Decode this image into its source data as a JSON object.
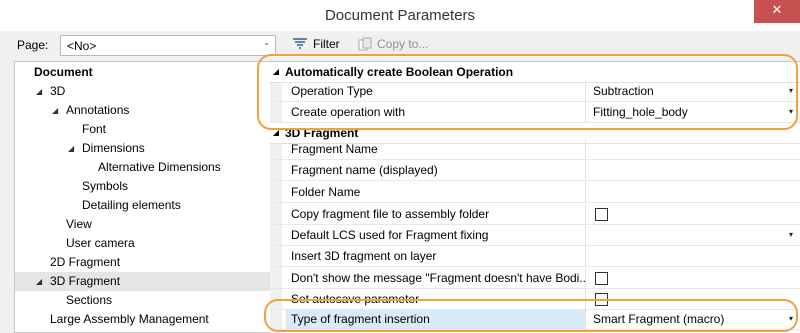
{
  "window": {
    "title": "Document Parameters",
    "close_glyph": "✕"
  },
  "page_selector": {
    "label": "Page:",
    "value": "<No>",
    "arrow": "⌄"
  },
  "toolbar": {
    "filter_label": "Filter",
    "copy_label": "Copy to..."
  },
  "tree": {
    "items": [
      {
        "label": "Document",
        "arrow": "",
        "bold": true
      },
      {
        "label": "3D",
        "arrow": "◢"
      },
      {
        "label": "Annotations",
        "arrow": "◢"
      },
      {
        "label": "Font",
        "arrow": ""
      },
      {
        "label": "Dimensions",
        "arrow": "◢"
      },
      {
        "label": "Alternative Dimensions",
        "arrow": ""
      },
      {
        "label": "Symbols",
        "arrow": ""
      },
      {
        "label": "Detailing elements",
        "arrow": ""
      },
      {
        "label": "View",
        "arrow": ""
      },
      {
        "label": "User camera",
        "arrow": ""
      },
      {
        "label": "2D Fragment",
        "arrow": ""
      },
      {
        "label": "3D Fragment",
        "arrow": "◢"
      },
      {
        "label": "Sections",
        "arrow": ""
      },
      {
        "label": "Large Assembly Management",
        "arrow": ""
      }
    ]
  },
  "grid": {
    "categories": [
      {
        "label": "Automatically create Boolean Operation",
        "arrow": "◢"
      },
      {
        "label": "3D Fragment",
        "arrow": "◢"
      }
    ],
    "boolean_rows": [
      {
        "name": "Operation Type",
        "value": "Subtraction",
        "arrow": "▾"
      },
      {
        "name": "Create operation with",
        "value": "Fitting_hole_body",
        "arrow": "▾"
      }
    ],
    "fragment_rows": [
      {
        "name": "Fragment Name",
        "value": ""
      },
      {
        "name": "Fragment name (displayed)",
        "value": ""
      },
      {
        "name": "Folder Name",
        "value": ""
      },
      {
        "name": "Copy fragment file to assembly folder",
        "value": ""
      },
      {
        "name": "Default LCS used for Fragment fixing",
        "value": "",
        "arrow": "▾"
      },
      {
        "name": "Insert 3D fragment on layer",
        "value": ""
      },
      {
        "name": "Don't show the message \"Fragment doesn't have Bodi...",
        "value": ""
      },
      {
        "name": "Set autosave parameter",
        "value": ""
      },
      {
        "name": "Type of fragment insertion",
        "value": "Smart Fragment (macro)",
        "arrow": "▾"
      }
    ]
  },
  "colors": {
    "callout": "#f0a040",
    "close": "#c75050",
    "highlight": "#d9ebf9"
  }
}
